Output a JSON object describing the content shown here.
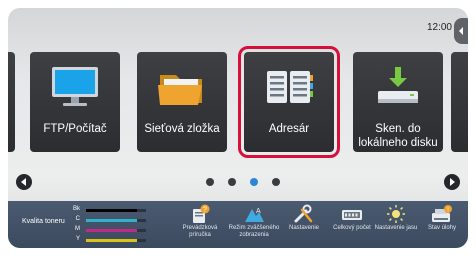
{
  "status": {
    "clock": "12:00"
  },
  "tiles": [
    {
      "id": "ftp",
      "label": "FTP/Počítač",
      "icon": "monitor-icon",
      "selected": false
    },
    {
      "id": "network-folder",
      "label": "Sieťová zložka",
      "icon": "folder-icon",
      "selected": false
    },
    {
      "id": "address-book",
      "label": "Adresár",
      "icon": "address-book-icon",
      "selected": true
    },
    {
      "id": "scan-local",
      "label": "Sken. do lokálneho disku",
      "icon": "local-disk-download-icon",
      "selected": false
    }
  ],
  "pager": {
    "pages": 4,
    "active_index": 2
  },
  "toner": {
    "label": "Kvalita toneru",
    "levels": [
      {
        "letter": "Bk",
        "color": "#000000",
        "level": 0.85
      },
      {
        "letter": "C",
        "color": "#2fb3c9",
        "level": 0.85
      },
      {
        "letter": "M",
        "color": "#c02a84",
        "level": 0.85
      },
      {
        "letter": "Y",
        "color": "#d9c21a",
        "level": 0.85
      }
    ]
  },
  "shortcuts": [
    {
      "label": "Prevádzková príručka",
      "icon": "book-question-icon"
    },
    {
      "label": "Režim zväčšeného zobrazenia",
      "icon": "large-display-mode-icon"
    },
    {
      "label": "Nastavenie",
      "icon": "wrench-screwdriver-icon"
    },
    {
      "label": "Celkový počet",
      "icon": "counter-icon"
    },
    {
      "label": "Nastavenie jasu",
      "icon": "brightness-icon"
    },
    {
      "label": "Stav úlohy",
      "icon": "job-status-icon"
    }
  ],
  "colors": {
    "selection": "#d6103a",
    "active_dot": "#2f86d6"
  }
}
